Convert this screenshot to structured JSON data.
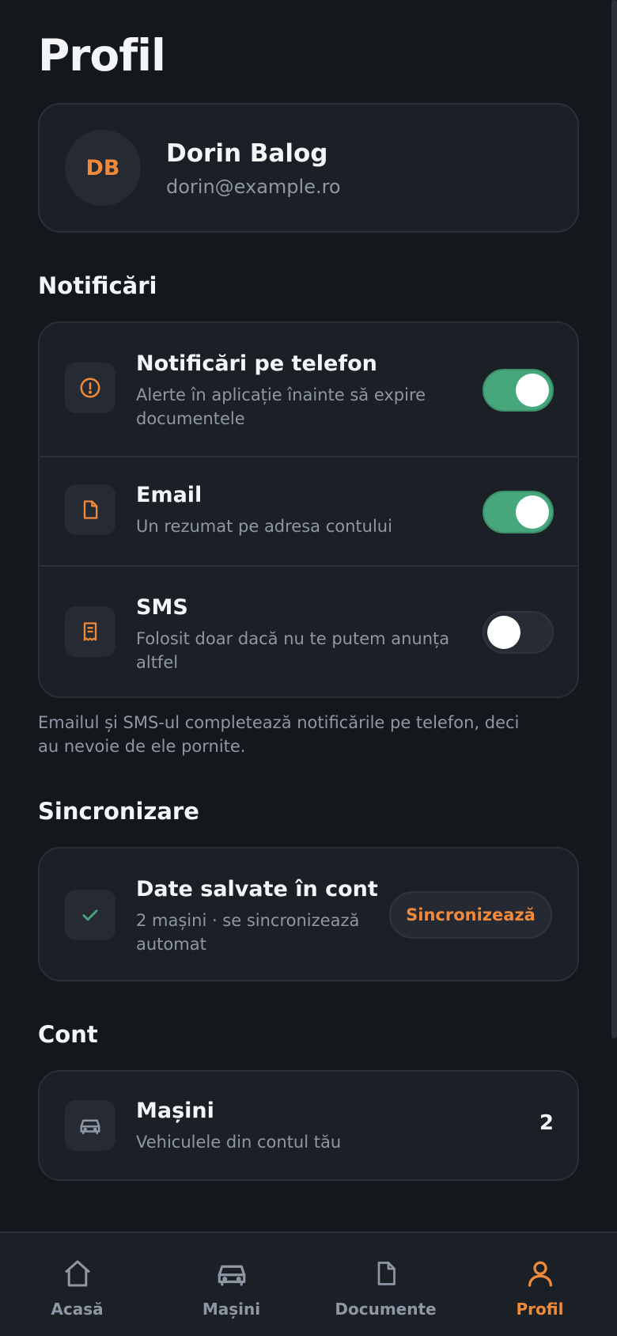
{
  "page": {
    "title": "Profil"
  },
  "profile": {
    "initials": "DB",
    "name": "Dorin Balog",
    "email": "dorin@example.ro"
  },
  "notifications": {
    "heading": "Notificări",
    "items": [
      {
        "icon": "alert-circle-icon",
        "title": "Notificări pe telefon",
        "subtitle": "Alerte în aplicație înainte să expire documentele",
        "enabled": true
      },
      {
        "icon": "document-icon",
        "title": "Email",
        "subtitle": "Un rezumat pe adresa contului",
        "enabled": true
      },
      {
        "icon": "receipt-icon",
        "title": "SMS",
        "subtitle": "Folosit doar dacă nu te putem anunța altfel",
        "enabled": false
      }
    ],
    "note": "Emailul și SMS-ul completează notificările pe telefon, deci au nevoie de ele pornite."
  },
  "sync": {
    "heading": "Sincronizare",
    "icon": "check-icon",
    "title": "Date salvate în cont",
    "subtitle": "2 mașini · se sincronizează automat",
    "button_label": "Sincronizează"
  },
  "account": {
    "heading": "Cont",
    "items": [
      {
        "icon": "car-icon",
        "title": "Mașini",
        "subtitle": "Vehiculele din contul tău",
        "count": "2"
      }
    ]
  },
  "tabbar": {
    "tabs": [
      {
        "icon": "home-icon",
        "label": "Acasă",
        "active": false
      },
      {
        "icon": "car-icon",
        "label": "Mașini",
        "active": false
      },
      {
        "icon": "document-icon",
        "label": "Documente",
        "active": false
      },
      {
        "icon": "user-icon",
        "label": "Profil",
        "active": true
      }
    ]
  },
  "colors": {
    "background": "#14171c",
    "card": "#1b1f26",
    "accent": "#f08a38",
    "toggle_on": "#46a77c",
    "muted_text": "#8f97a5",
    "success": "#46a77c"
  }
}
